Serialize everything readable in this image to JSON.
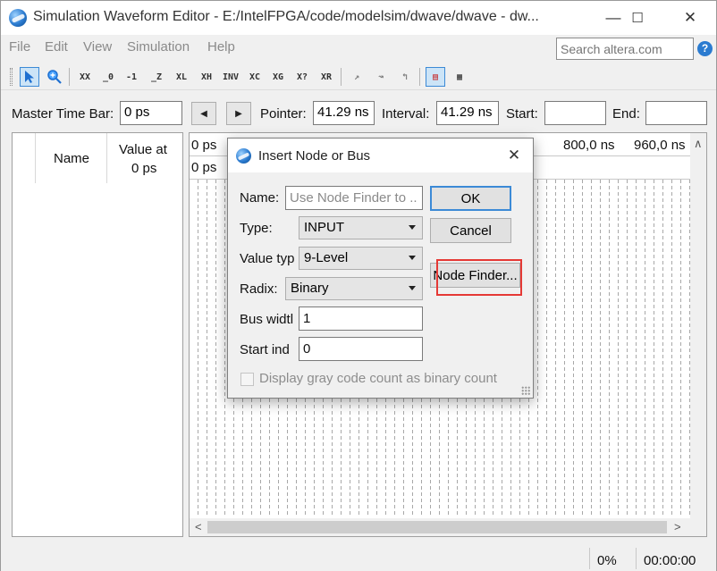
{
  "window": {
    "title": "Simulation Waveform Editor - E:/IntelFPGA/code/modelsim/dwave/dwave - dw..."
  },
  "menu": [
    "File",
    "Edit",
    "View",
    "Simulation",
    "Help"
  ],
  "search": {
    "placeholder": "Search altera.com"
  },
  "toolbar": {
    "items": [
      "selection-tool",
      "zoom-tool",
      "forcing-unknown",
      "forcing-low-0",
      "forcing-high-1",
      "high-impedance-z",
      "weak-low-l",
      "weak-high-h",
      "weak-unknown",
      "invert",
      "count-value",
      "forcing-clock",
      "arbitrary-value",
      "random-value",
      "snap-to-grid",
      "grid-size",
      "group",
      "ungroup",
      "sort"
    ]
  },
  "timebar": {
    "master_label": "Master Time Bar:",
    "master_value": "0 ps",
    "pointer_label": "Pointer:",
    "pointer_value": "41.29 ns",
    "interval_label": "Interval:",
    "interval_value": "41.29 ns",
    "start_label": "Start:",
    "start_value": "",
    "end_label": "End:",
    "end_value": ""
  },
  "node_panel": {
    "name_header": "Name",
    "value_header_line1": "Value at",
    "value_header_line2": "0 ps"
  },
  "wave_panel": {
    "ruler_start": "0 ps",
    "tick_800": "800,0 ns",
    "tick_960": "960,0 ns",
    "row2_label": "0 ps"
  },
  "status": {
    "progress": "0%",
    "time": "00:00:00"
  },
  "dialog": {
    "title": "Insert Node or Bus",
    "name_label": "Name:",
    "name_placeholder": "Use Node Finder to ...",
    "type_label": "Type:",
    "type_value": "INPUT",
    "value_type_label": "Value typ",
    "value_type_value": "9-Level",
    "radix_label": "Radix:",
    "radix_value": "Binary",
    "bus_width_label": "Bus widtl",
    "bus_width_value": "1",
    "start_index_label": "Start ind",
    "start_index_value": "0",
    "gray_code_label": "Display gray code count as binary count",
    "ok_label": "OK",
    "cancel_label": "Cancel",
    "node_finder_label": "Node Finder..."
  },
  "colors": {
    "accent": "#3c8ad6",
    "highlight": "#e53935"
  }
}
